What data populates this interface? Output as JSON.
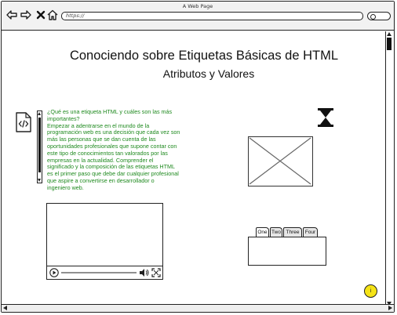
{
  "window": {
    "title": "A Web Page"
  },
  "address_bar": {
    "url": "https://"
  },
  "icons": {
    "back": "arrow-left-icon",
    "forward": "arrow-right-icon",
    "close": "close-icon",
    "home": "home-icon",
    "search": "search-icon",
    "document": "html-file-icon",
    "hourglass": "hourglass-icon",
    "image": "image-placeholder-icon",
    "play": "play-icon",
    "volume": "volume-icon",
    "fullscreen": "fullscreen-icon"
  },
  "page": {
    "heading": "Conociendo sobre Etiquetas Básicas de HTML",
    "subheading": "Atributos y Valores",
    "paragraph_lines": [
      "¿Qué es una etiqueta HTML y cuáles son las más",
      "importantes?",
      "Empezar a adentrarse en el mundo de la",
      "programación web es una decisión que cada vez son",
      "más las personas que se dan cuenta de las",
      "oportunidades profesionales que supone contar con",
      "este tipo de conocimientos tan valorados por las",
      "empresas en la actualidad. Comprender el",
      "significado y la composición de las etiquetas HTML",
      "es el primer paso que debe dar cualquier profesional",
      "que aspire a convertirse en desarrollador o",
      "ingeniero web."
    ]
  },
  "tabs": [
    {
      "label": "One",
      "active": true
    },
    {
      "label": "Two",
      "active": false
    },
    {
      "label": "Three",
      "active": false
    },
    {
      "label": "Four",
      "active": false
    }
  ],
  "help_badge": {
    "label": "i"
  },
  "colors": {
    "paragraph_text": "#1f8a1f",
    "help_badge": "#f5e316"
  }
}
